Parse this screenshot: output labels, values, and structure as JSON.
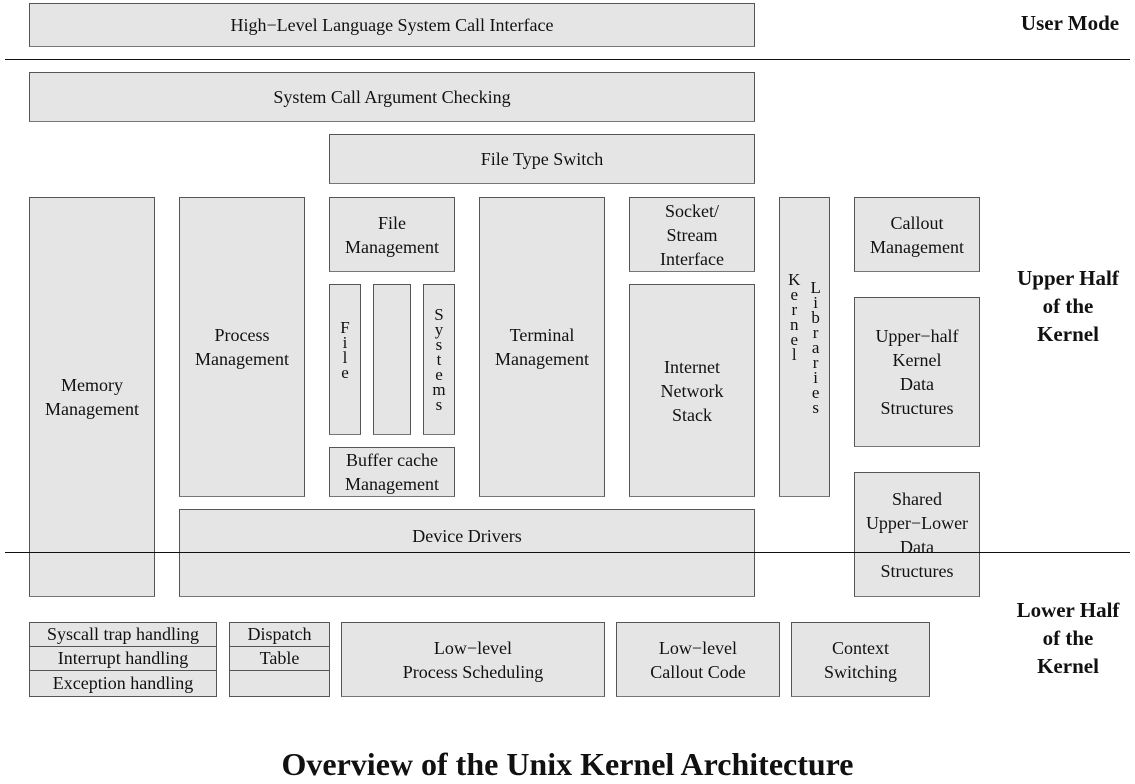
{
  "diagram": {
    "title": "Overview of the Unix Kernel Architecture",
    "regions": {
      "user_mode": "User Mode",
      "upper_half": "Upper Half\nof the\nKernel",
      "lower_half": "Lower Half\nof the\nKernel"
    },
    "boxes": {
      "hll_interface": "High−Level Language System Call Interface",
      "arg_checking": "System Call Argument Checking",
      "file_type_switch": "File Type Switch",
      "memory_management": "Memory\nManagement",
      "process_management": "Process\nManagement",
      "file_management": "File\nManagement",
      "file_systems_left": [
        "F",
        "i",
        "l",
        "e"
      ],
      "file_systems_right": [
        "S",
        "y",
        "s",
        "t",
        "e",
        "m",
        "s"
      ],
      "buffer_cache": "Buffer cache\nManagement",
      "terminal_management": "Terminal\nManagement",
      "socket_stream": "Socket/\nStream\nInterface",
      "internet_stack": "Internet\nNetwork\nStack",
      "kernel_libraries_left": [
        "K",
        "e",
        "r",
        "n",
        "e",
        "l"
      ],
      "kernel_libraries_right": [
        "L",
        "i",
        "b",
        "r",
        "a",
        "r",
        "i",
        "e",
        "s"
      ],
      "callout_management": "Callout\nManagement",
      "upper_half_data": "Upper−half\nKernel\nData\nStructures",
      "shared_data": "Shared\nUpper−Lower\nData\nStructures",
      "device_drivers": "Device Drivers",
      "trap_handling": [
        "Syscall trap handling",
        "Interrupt handling",
        "Exception handling"
      ],
      "dispatch_table": [
        "Dispatch",
        "Table",
        ""
      ],
      "low_level_scheduling": "Low−level\nProcess Scheduling",
      "low_level_callout": "Low−level\nCallout Code",
      "context_switching": "Context\nSwitching"
    }
  }
}
